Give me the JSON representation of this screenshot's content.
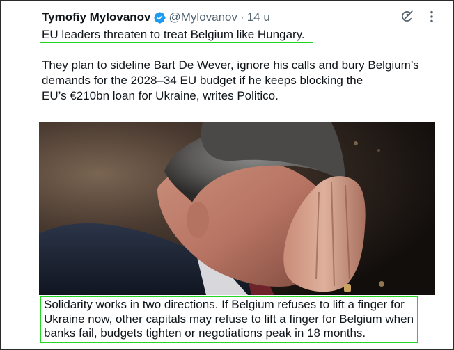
{
  "tweet": {
    "author_name": "Tymofiy Mylovanov",
    "handle": "@Mylovanov",
    "separator": "·",
    "time": "14 u",
    "headline": "EU leaders threaten to treat Belgium like Hungary.",
    "body_lines": [
      "They plan to sideline Bart De Wever, ignore his calls and bury Belgium’s",
      "demands for the 2028–34 EU budget if he keeps blocking the",
      "EU’s €210bn loan for Ukraine, writes Politico."
    ],
    "caption_lines": [
      "Solidarity works in two directions. If Belgium refuses to lift a finger for",
      "Ukraine now, other capitals may refuse to lift a finger for Belgium when",
      "banks fail, budgets tighten or negotiations peak in 18 months."
    ]
  },
  "icons": {
    "verified": "verified-badge-icon",
    "grok": "grok-icon",
    "more": "more-options-icon"
  },
  "colors": {
    "text": "#0f1419",
    "secondary": "#536471",
    "verified_blue": "#1d9bf0",
    "highlight_green": "#1ed81e"
  }
}
